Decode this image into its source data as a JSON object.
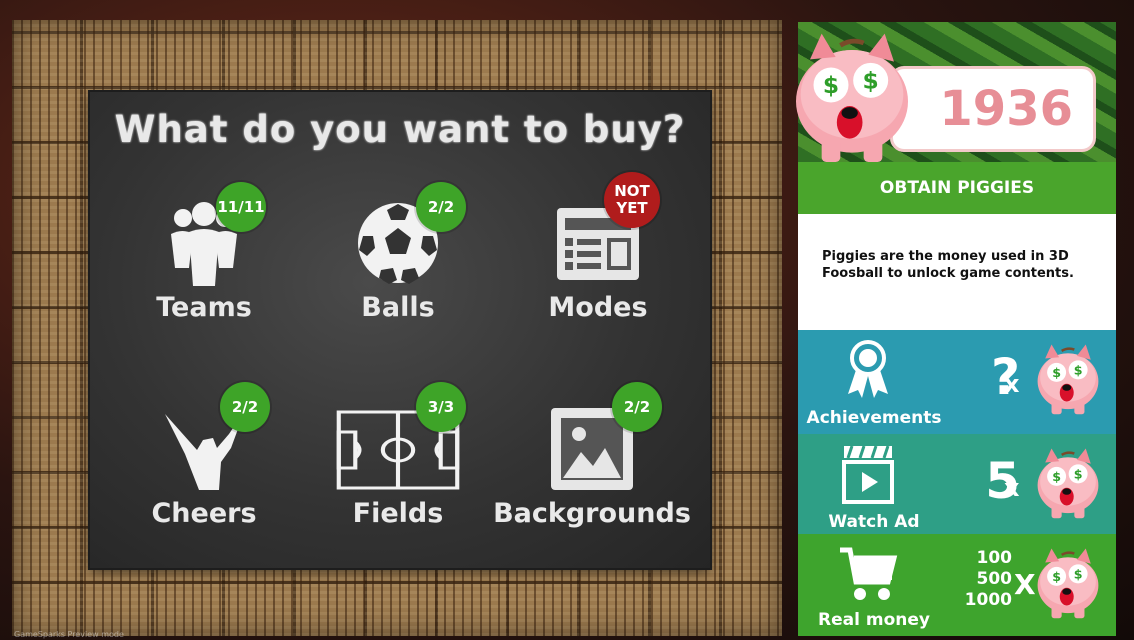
{
  "shop": {
    "title": "What do you want to buy?",
    "items": [
      {
        "label": "Teams",
        "badge": "11/11",
        "badge_state": "complete",
        "icon": "teams-icon"
      },
      {
        "label": "Balls",
        "badge": "2/2",
        "badge_state": "complete",
        "icon": "soccer-ball-icon"
      },
      {
        "label": "Modes",
        "badge": "NOT YET",
        "badge_state": "locked",
        "icon": "modes-icon"
      },
      {
        "label": "Cheers",
        "badge": "2/2",
        "badge_state": "complete",
        "icon": "cheers-icon"
      },
      {
        "label": "Fields",
        "badge": "3/3",
        "badge_state": "complete",
        "icon": "field-icon"
      },
      {
        "label": "Backgrounds",
        "badge": "2/2",
        "badge_state": "complete",
        "icon": "picture-icon"
      }
    ]
  },
  "wallet": {
    "piggies": "1936"
  },
  "obtain": {
    "title": "OBTAIN PIGGIES",
    "description": "Piggies are the money used in 3D Foosball to unlock game contents.",
    "options": [
      {
        "label": "Achievements",
        "amount": "?",
        "times": "x",
        "icon": "award-ribbon-icon"
      },
      {
        "label": "Watch Ad",
        "amount": "5",
        "times": "x",
        "icon": "video-clapper-icon"
      },
      {
        "label": "Real money",
        "amounts": [
          "100",
          "500",
          "1000"
        ],
        "times": "X",
        "icon": "shopping-cart-icon"
      }
    ]
  },
  "footer": "GameSparks Preview mode",
  "colors": {
    "badge_green": "#3ea428",
    "badge_red": "#b01c1c",
    "coin_text": "#e78e96",
    "obtain_green": "#4aa52c",
    "achievements_blue": "#2b9bb0",
    "watch_ad_teal": "#2e9f86",
    "real_money_green": "#3ea42d"
  }
}
